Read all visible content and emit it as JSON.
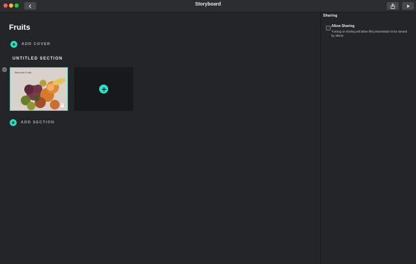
{
  "window": {
    "title": "Storyboard"
  },
  "main": {
    "title": "Fruits",
    "add_cover_label": "ADD COVER",
    "section_name": "UNTITLED SECTION",
    "add_section_label": "ADD SECTION",
    "slide": {
      "placeholder_text": "Welcome Fruits",
      "locked": true
    }
  },
  "sidebar": {
    "heading": "Sharing",
    "allow_sharing_label": "Allow Sharing",
    "allow_sharing_checked": false,
    "allow_sharing_description": "Turning on sharing will allow this presentation to be viewed by others."
  },
  "colors": {
    "accent": "#2de0c2",
    "background": "#242529",
    "add_slide_bg": "#18191c"
  },
  "icons": {
    "back": "chevron-left-icon",
    "share": "share-icon",
    "play": "play-icon",
    "lock": "lock-icon",
    "plus": "plus-icon",
    "check": "check-icon"
  }
}
